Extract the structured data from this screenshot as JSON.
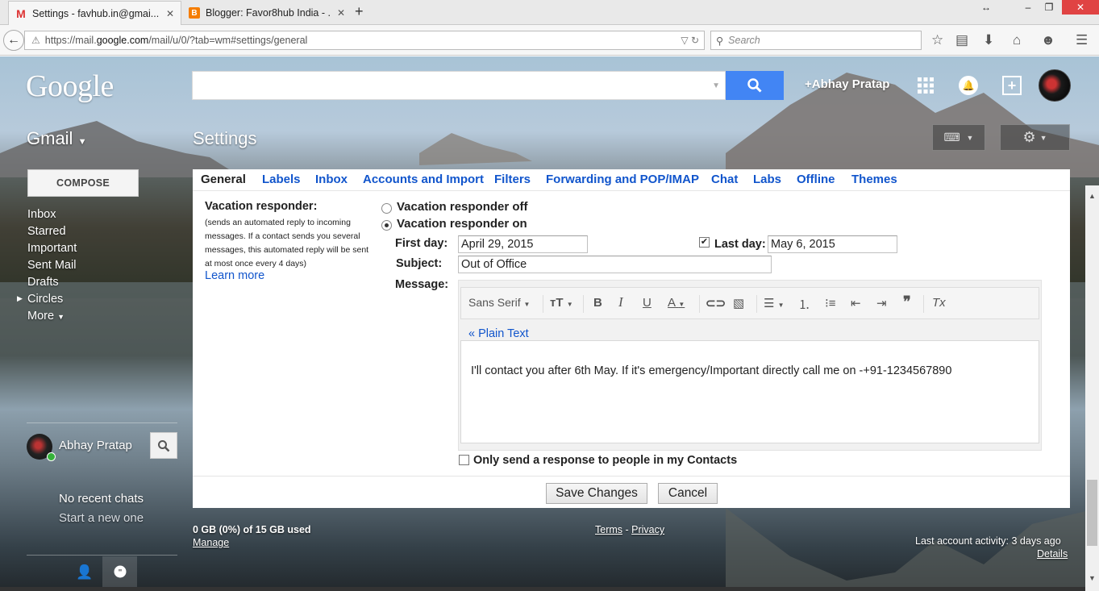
{
  "browser": {
    "tabs": [
      {
        "title": "Settings - favhub.in@gmai...",
        "favicon": "gmail-icon",
        "active": true
      },
      {
        "title": "Blogger: Favor8hub India - ...",
        "favicon": "blogger-icon",
        "active": false
      }
    ],
    "new_tab": "+",
    "window_controls": {
      "resize": "↔",
      "minimize": "–",
      "maximize": "❐",
      "close": "✕"
    },
    "url_prefix": "https://mail.",
    "url_domain": "google.com",
    "url_path": "/mail/u/0/?tab=wm#settings/general",
    "search_placeholder": "Search",
    "nav_icons": [
      "star-icon",
      "reading-list-icon",
      "download-icon",
      "home-icon",
      "chat-icon",
      "menu-icon"
    ]
  },
  "header": {
    "logo": "Google",
    "search_value": "",
    "user_label": "+Abhay Pratap"
  },
  "gmail": {
    "menu_label": "Gmail",
    "page_title": "Settings",
    "compose_label": "COMPOSE",
    "nav": [
      "Inbox",
      "Starred",
      "Important",
      "Sent Mail",
      "Drafts",
      "Circles",
      "More"
    ]
  },
  "chat": {
    "user_name": "Abhay Pratap",
    "no_recent": "No recent chats",
    "start_new": "Start a new one"
  },
  "settings": {
    "tabs": [
      "General",
      "Labels",
      "Inbox",
      "Accounts and Import",
      "Filters",
      "Forwarding and POP/IMAP",
      "Chat",
      "Labs",
      "Offline",
      "Themes"
    ],
    "active_tab": "General",
    "vacation": {
      "label": "Vacation responder:",
      "help": "(sends an automated reply to incoming messages. If a contact sends you several messages, this automated reply will be sent at most once every 4 days)",
      "learn_more": "Learn more",
      "off_label": "Vacation responder off",
      "on_label": "Vacation responder on",
      "selected": "on",
      "first_day_label": "First day:",
      "first_day_value": "April 29, 2015",
      "last_day_label": "Last day:",
      "last_day_checked": true,
      "last_day_value": "May 6, 2015",
      "subject_label": "Subject:",
      "subject_value": "Out of Office",
      "message_label": "Message:",
      "font_name": "Sans Serif",
      "plain_text_link": "« Plain Text",
      "message_body": "I'll contact you after 6th May. If it's emergency/Important directly call me on -+91-1234567890",
      "contacts_only_label": "Only send a response to people in my Contacts",
      "contacts_only_checked": false
    },
    "save_label": "Save Changes",
    "cancel_label": "Cancel"
  },
  "footer": {
    "storage": "0 GB (0%) of 15 GB used",
    "manage": "Manage",
    "terms": "Terms",
    "dash": " - ",
    "privacy": "Privacy",
    "last_activity": "Last account activity: 3 days ago",
    "details": "Details"
  }
}
